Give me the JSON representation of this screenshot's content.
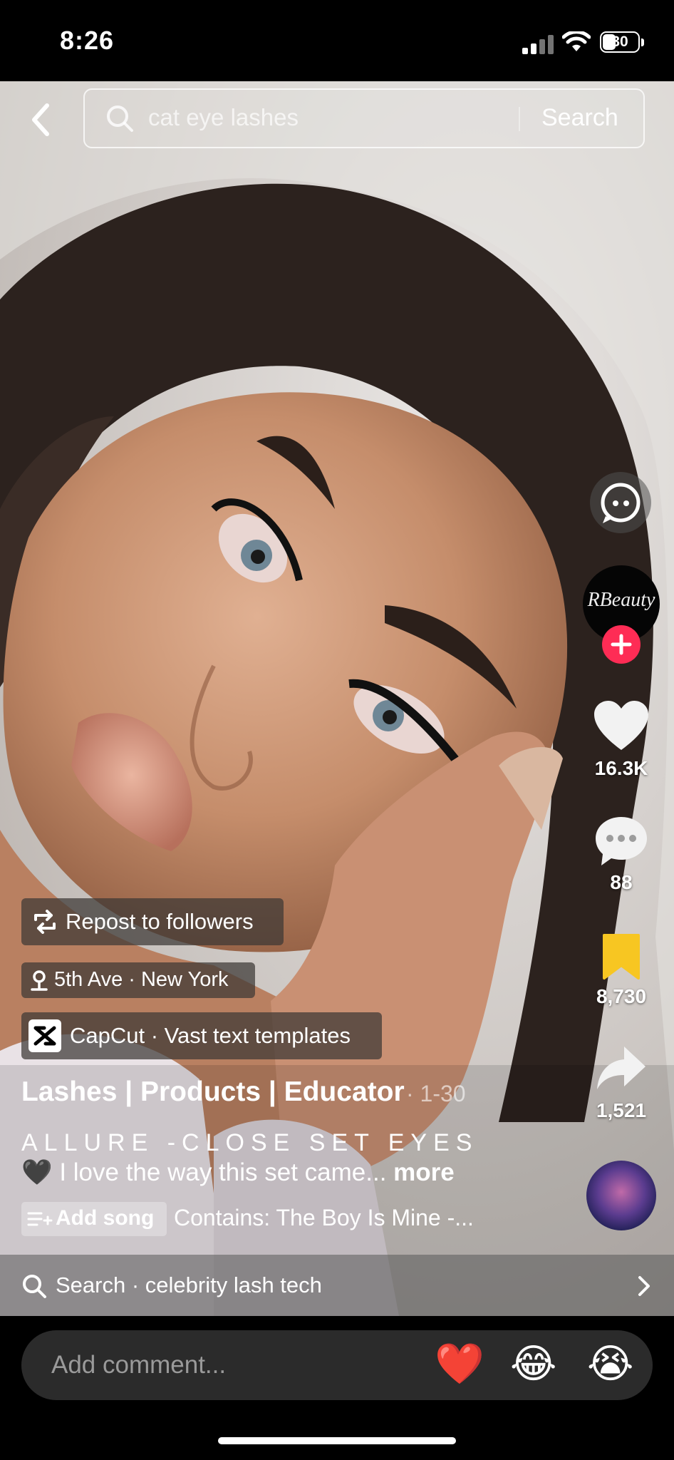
{
  "status_bar": {
    "time": "8:26",
    "battery": "30"
  },
  "search": {
    "query": "cat eye lashes",
    "button_label": "Search"
  },
  "rail": {
    "avatar_text": "RBeauty",
    "likes": "16.3K",
    "comments": "88",
    "saves": "8,730",
    "shares": "1,521"
  },
  "overlay": {
    "repost_label": "Repost to followers",
    "location": "5th Ave · New York",
    "capcut_label": "CapCut · Vast text templates",
    "author": "Lashes | Products | Educator",
    "date": "· 1-30",
    "caption_title": "ALLURE -CLOSE SET EYES",
    "caption_emoji": "🖤",
    "caption_text": "I love the way this set came...",
    "more_label": "more",
    "add_song_label": "Add song",
    "song_text": "Contains: The Boy Is Mine -..."
  },
  "bottom_search": {
    "label": "Search · celebrity lash tech"
  },
  "comment": {
    "placeholder": "Add comment...",
    "emojis": [
      "❤️",
      "😂",
      "😭"
    ]
  },
  "colors": {
    "follow": "#fe2c55",
    "save_active": "#f7c622"
  }
}
